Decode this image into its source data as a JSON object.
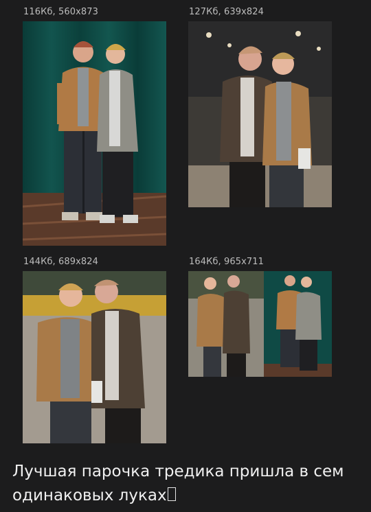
{
  "images": [
    {
      "caption": "116Кб, 560x873",
      "alt_icon": "photo-two-men-green-curtain"
    },
    {
      "caption": "127Кб, 639x824",
      "alt_icon": "photo-two-men-street-night"
    },
    {
      "caption": "144Кб, 689x824",
      "alt_icon": "photo-two-men-city-street"
    },
    {
      "caption": "164Кб, 965x711",
      "alt_icon": "photo-collage-two-photos"
    }
  ],
  "post": {
    "line1": "Лучшая парочка тредика пришла в сем",
    "line2": "одинаковых луках"
  },
  "colors": {
    "background": "#1c1c1d",
    "caption": "#bdbdbd",
    "text": "#f0f0f0",
    "curtain": "#0f4a45",
    "jacket_tan": "#b07a45",
    "jacket_brown": "#4e4035"
  }
}
